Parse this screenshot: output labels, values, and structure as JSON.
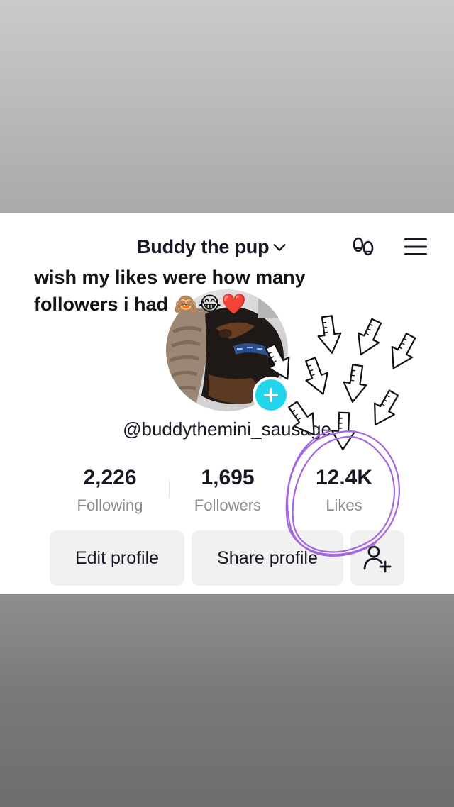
{
  "profile": {
    "display_name": "Buddy the pup",
    "username": "@buddythemini_sausage",
    "caption_line1": "wish my likes were how many",
    "caption_line2": "followers  i had",
    "caption_emojis": "🙈😂❤️"
  },
  "stats": [
    {
      "value": "2,226",
      "label": "Following"
    },
    {
      "value": "1,695",
      "label": "Followers"
    },
    {
      "value": "12.4K",
      "label": "Likes"
    }
  ],
  "buttons": {
    "edit": "Edit profile",
    "share": "Share profile"
  },
  "icons": {
    "footprints": "footprints-icon",
    "menu": "hamburger-menu-icon",
    "chevron": "chevron-down-icon",
    "add": "plus-icon",
    "add_friend": "add-friend-icon"
  },
  "colors": {
    "accent": "#20d5ec",
    "annotation": "#a565e0"
  }
}
